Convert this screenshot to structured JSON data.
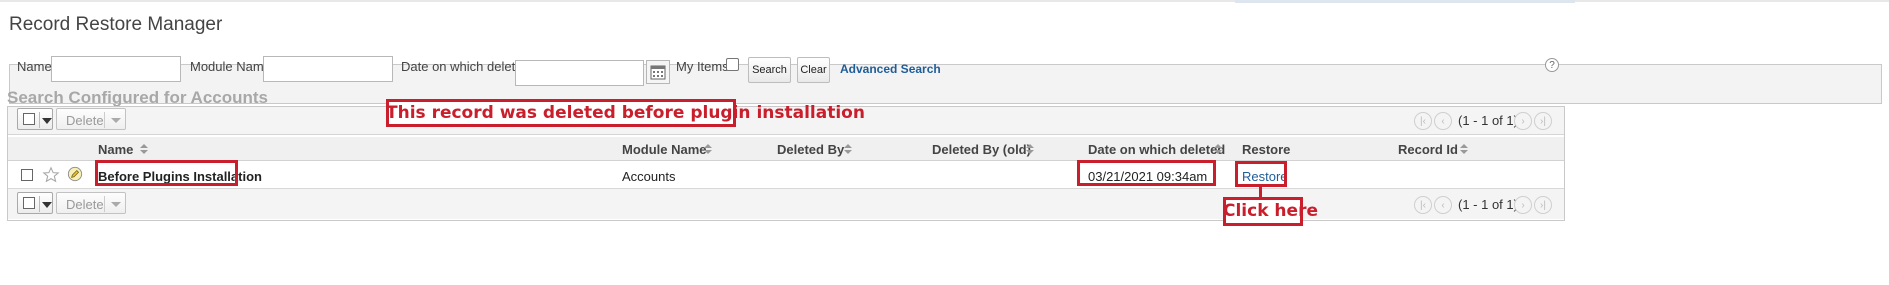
{
  "page": {
    "title": "Record Restore Manager",
    "section_title": "Search Configured for Accounts"
  },
  "search": {
    "name_label": "Name",
    "module_name_label": "Module Name",
    "date_deleted_label": "Date on which deleted",
    "my_items_label": "My Items",
    "search_button": "Search",
    "clear_button": "Clear",
    "advanced_search_link": "Advanced Search",
    "help_icon": "?"
  },
  "toolbar": {
    "delete_label": "Delete",
    "pagination_text": "(1 - 1 of 1)"
  },
  "table": {
    "columns": [
      "Name",
      "Module Name",
      "Deleted By",
      "Deleted By (old)",
      "Date on which deleted",
      "Restore",
      "Record Id"
    ],
    "rows": [
      {
        "name": "Before Plugins Installation",
        "module_name": "Accounts",
        "deleted_by": "",
        "deleted_by_old": "",
        "date_deleted": "03/21/2021 09:34am",
        "restore": "Restore",
        "record_id": ""
      }
    ]
  },
  "annotations": {
    "deleted_note": "This record was deleted before plugin installation",
    "click_here": "Click here"
  },
  "colors": {
    "annotation_red": "#c91f2c",
    "link_blue": "#1f5d99",
    "panel_gray": "#f3f3f3"
  }
}
